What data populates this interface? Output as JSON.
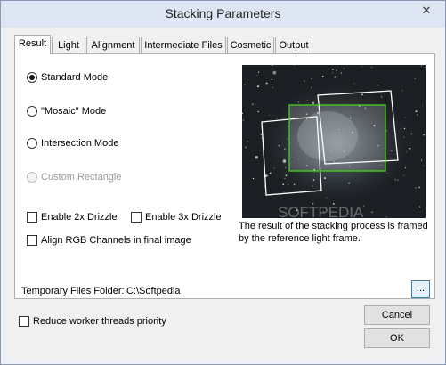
{
  "window": {
    "title": "Stacking Parameters",
    "close_glyph": "✕"
  },
  "tabs": [
    {
      "label": "Result",
      "active": true
    },
    {
      "label": "Light"
    },
    {
      "label": "Alignment"
    },
    {
      "label": "Intermediate Files"
    },
    {
      "label": "Cosmetic"
    },
    {
      "label": "Output"
    }
  ],
  "modes": [
    {
      "label": "Standard Mode",
      "checked": true
    },
    {
      "label": "\"Mosaic\" Mode",
      "checked": false
    },
    {
      "label": "Intersection Mode",
      "checked": false
    },
    {
      "label": "Custom Rectangle",
      "checked": false,
      "disabled": true
    }
  ],
  "options": {
    "drizzle_2x": "Enable 2x Drizzle",
    "drizzle_3x": "Enable 3x Drizzle",
    "align_rgb": "Align RGB Channels in final image"
  },
  "preview": {
    "caption": "The result of the stacking process is framed by the reference light frame.",
    "watermark": "SOFTPEDIA",
    "frame_color": "#ffffff",
    "result_color": "#46c81e"
  },
  "temp_folder": {
    "label": "Temporary Files Folder:",
    "value": "C:\\Softpedia",
    "browse_label": "..."
  },
  "reduce_threads": "Reduce worker threads priority",
  "buttons": {
    "cancel": "Cancel",
    "ok": "OK"
  },
  "colors": {
    "focus_border": "#3c7fb1"
  }
}
